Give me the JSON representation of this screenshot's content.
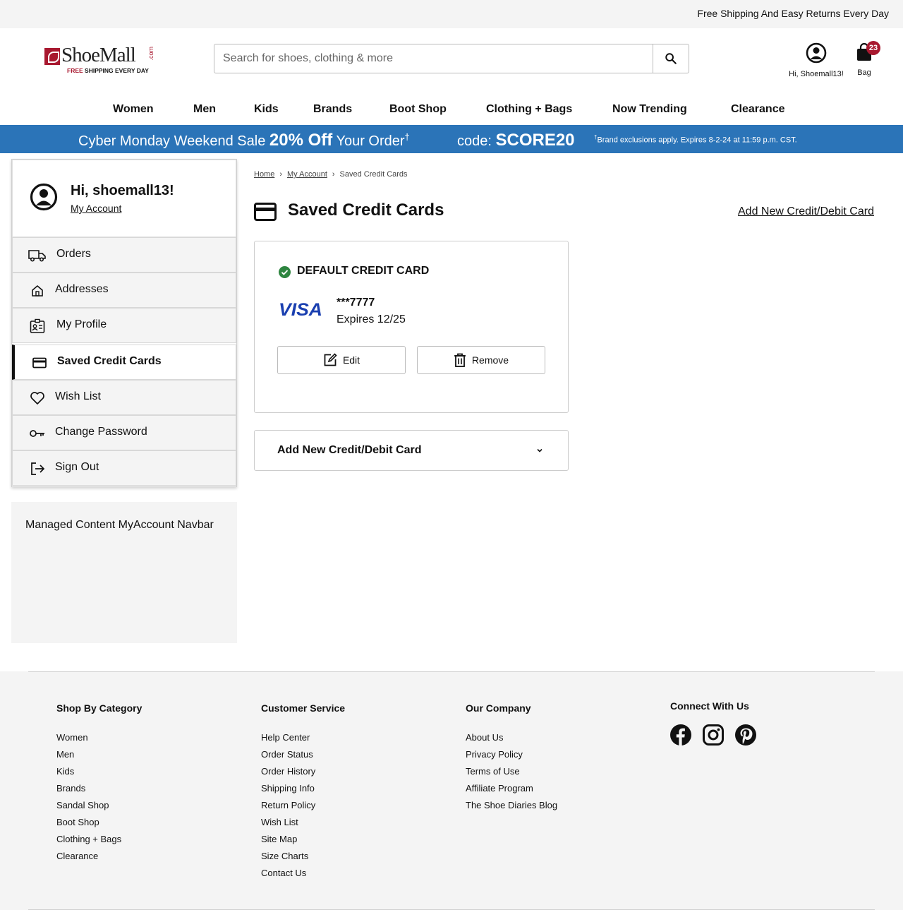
{
  "topbar": {
    "message": "Free Shipping And Easy Returns Every Day"
  },
  "logo": {
    "word": "ShoeMall",
    "dotcom": ".com",
    "tag_free": "FREE",
    "tag_rest": " SHIPPING EVERY DAY"
  },
  "search": {
    "placeholder": "Search for shoes, clothing & more"
  },
  "account": {
    "label": "Hi, Shoemall13!"
  },
  "bag": {
    "label": "Bag",
    "count": "23"
  },
  "nav": [
    "Women",
    "Men",
    "Kids",
    "Brands",
    "Boot Shop",
    "Clothing + Bags",
    "Now Trending",
    "Clearance"
  ],
  "promo": {
    "line1_pre": "Cyber Monday Weekend Sale ",
    "line1_bold": "20% Off",
    "line1_post": " Your Order",
    "dagger": "†",
    "code_label": "code: ",
    "code": "SCORE20",
    "fine": "Brand exclusions apply. Expires 8-2-24 at 11:59 p.m. CST."
  },
  "sidebar": {
    "greeting": "Hi, shoemall13!",
    "my_account": "My Account",
    "items": [
      {
        "label": "Orders",
        "icon": "truck-icon"
      },
      {
        "label": "Addresses",
        "icon": "home-icon"
      },
      {
        "label": "My Profile",
        "icon": "profile-icon"
      },
      {
        "label": "Saved Credit Cards",
        "icon": "credit-card-icon",
        "active": true
      },
      {
        "label": "Wish List",
        "icon": "heart-icon"
      },
      {
        "label": "Change Password",
        "icon": "key-icon"
      },
      {
        "label": "Sign Out",
        "icon": "sign-out-icon"
      }
    ]
  },
  "managed": {
    "text": "Managed Content MyAccount Navbar"
  },
  "breadcrumb": [
    "Home",
    "My Account",
    "Saved Credit Cards"
  ],
  "page": {
    "title": "Saved Credit Cards",
    "add_link": "Add New Credit/Debit Card"
  },
  "card": {
    "default_label": "DEFAULT CREDIT CARD",
    "brand": "VISA",
    "number": "***7777",
    "expires": "Expires 12/25",
    "edit": "Edit",
    "remove": "Remove"
  },
  "add_new": {
    "label": "Add New Credit/Debit Card"
  },
  "footer": {
    "shop": {
      "title": "Shop By Category",
      "links": [
        "Women",
        "Men",
        "Kids",
        "Brands",
        "Sandal Shop",
        "Boot Shop",
        "Clothing + Bags",
        "Clearance"
      ]
    },
    "service": {
      "title": "Customer Service",
      "links": [
        "Help Center",
        "Order Status",
        "Order History",
        "Shipping Info",
        "Return Policy",
        "Wish List",
        "Site Map",
        "Size Charts",
        "Contact Us"
      ]
    },
    "company": {
      "title": "Our Company",
      "links": [
        "About Us",
        "Privacy Policy",
        "Terms of Use",
        "Affiliate Program",
        "The Shoe Diaries Blog"
      ]
    },
    "connect": {
      "title": "Connect With Us",
      "icons": [
        "facebook-icon",
        "instagram-icon",
        "pinterest-icon"
      ]
    }
  },
  "colors": {
    "brand": "#a8182f",
    "promo": "#2b74b8",
    "success": "#2e8540",
    "visa": "#1a3fb0"
  }
}
